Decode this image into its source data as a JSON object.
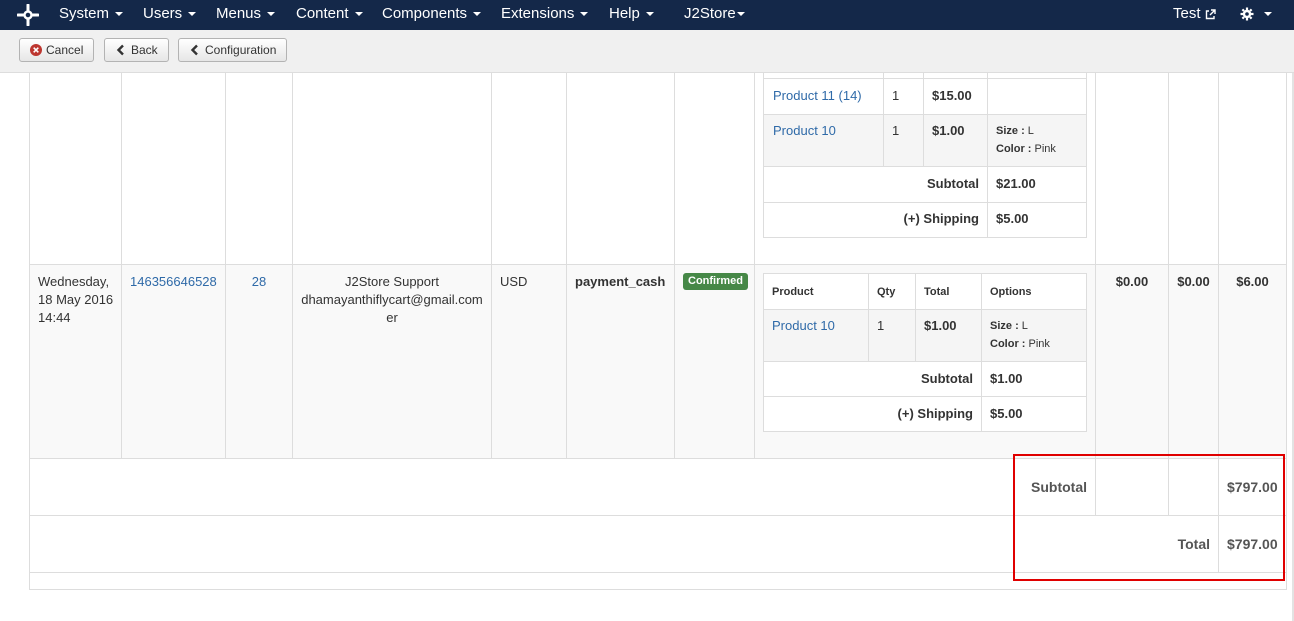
{
  "nav": {
    "menus": [
      "System",
      "Users",
      "Menus",
      "Content",
      "Components",
      "Extensions",
      "Help"
    ],
    "j2store": "J2Store",
    "user": "Test",
    "icons": {
      "logo": "joomla-logo-icon",
      "external": "external-link-icon",
      "settings": "gear-icon"
    }
  },
  "toolbar": {
    "cancel": "Cancel",
    "back": "Back",
    "configuration": "Configuration"
  },
  "order_prev": {
    "items": [
      {
        "product": "Product 11 (14)",
        "qty": "1",
        "total": "$15.00"
      },
      {
        "product": "Product 10",
        "qty": "1",
        "total": "$1.00",
        "size_label": "Size :",
        "size": "L",
        "color_label": "Color :",
        "color": "Pink"
      }
    ],
    "subtotal_label": "Subtotal",
    "subtotal": "$21.00",
    "shipping_label": "(+) Shipping",
    "shipping": "$5.00"
  },
  "order": {
    "date": "Wednesday, 18 May 2016 14:44",
    "order_id": "146356646528",
    "user_id": "28",
    "customer_name": "J2Store Support",
    "customer_email": "dhamayanthiflycart@gmail.com",
    "customer_email_tail": "er",
    "currency": "USD",
    "payment": "payment_cash",
    "status": "Confirmed",
    "status_color": "#468847",
    "items_headers": [
      "Product",
      "Qty",
      "Total",
      "Options"
    ],
    "items": [
      {
        "product": "Product 10",
        "qty": "1",
        "total": "$1.00",
        "size_label": "Size :",
        "size": "L",
        "color_label": "Color :",
        "color": "Pink"
      }
    ],
    "subtotal_label": "Subtotal",
    "subtotal": "$1.00",
    "shipping_label": "(+) Shipping",
    "shipping": "$5.00",
    "discount": "$0.00",
    "tax": "$0.00",
    "amount": "$6.00"
  },
  "totals": {
    "subtotal_label": "Subtotal",
    "subtotal": "$797.00",
    "total_label": "Total",
    "total": "$797.00"
  },
  "colors": {
    "nav_bg": "#142849",
    "link": "#2f6aa8",
    "highlight": "#e00000"
  }
}
